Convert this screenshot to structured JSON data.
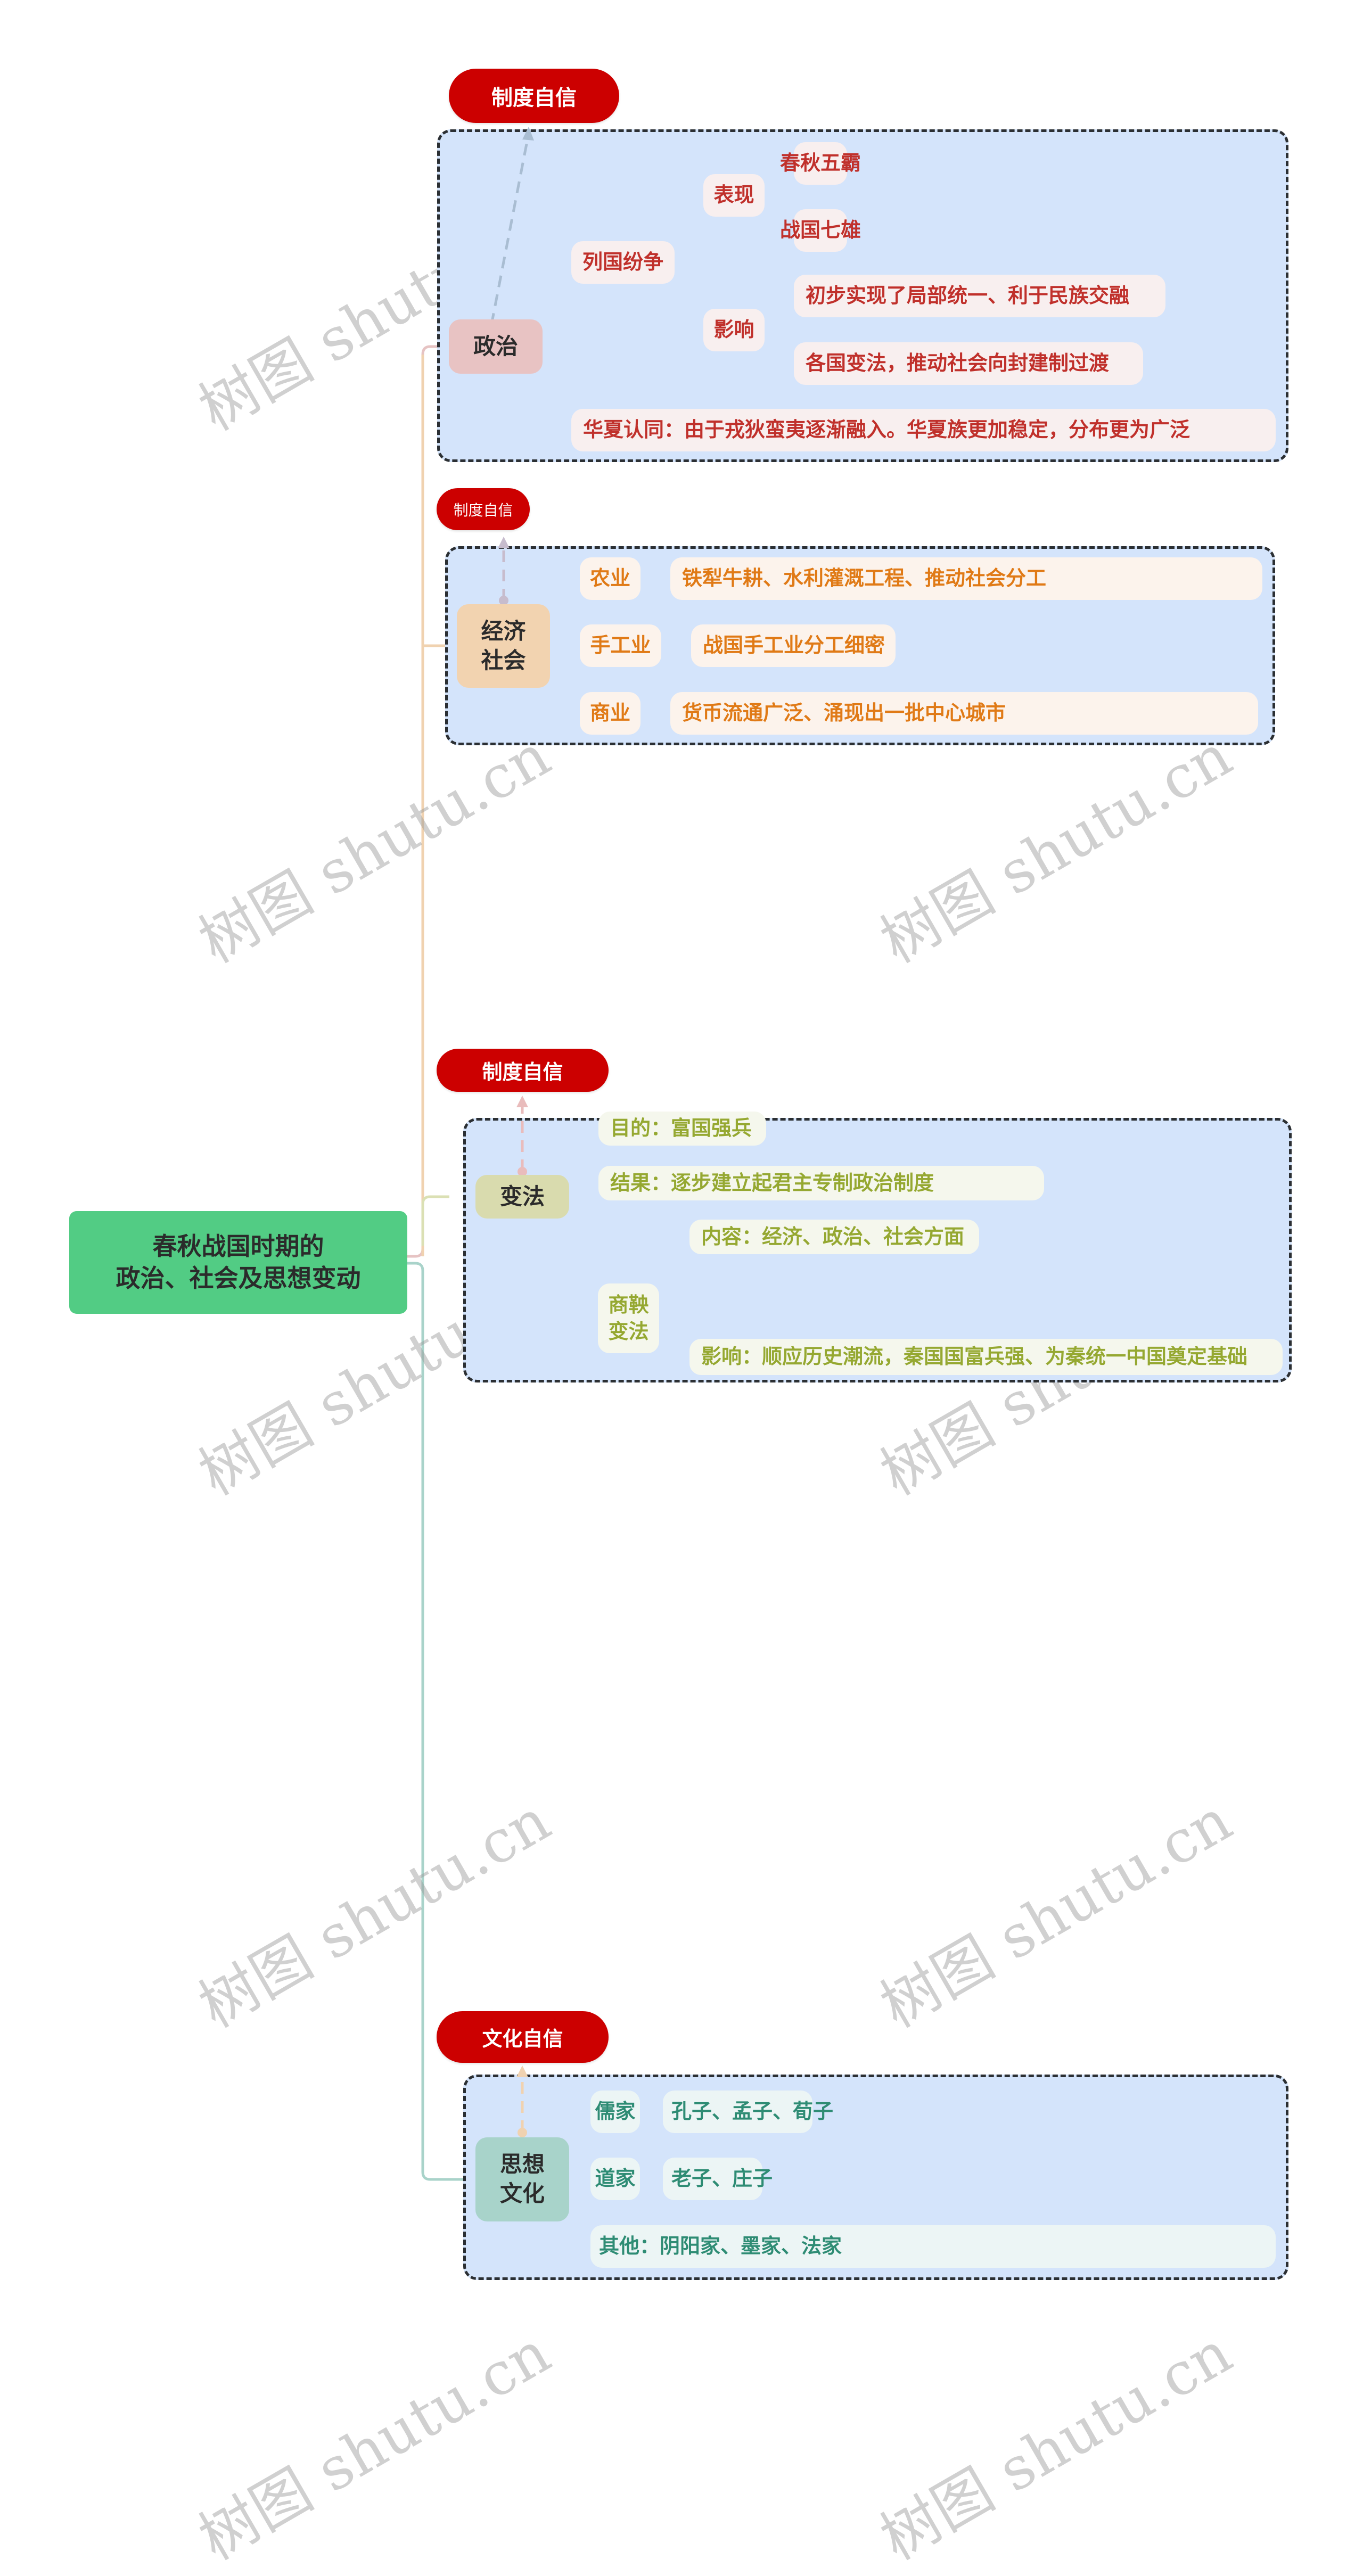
{
  "root": {
    "line1": "春秋战国时期的",
    "line2": "政治、社会及思想变动"
  },
  "colors": {
    "root_bg": "#52cc84",
    "pill_bg": "#cc0000",
    "group_bg": "#d4e4fb",
    "politics": "#c0302b",
    "economy": "#e07a16",
    "reform": "#95a831",
    "culture": "#2e8c74"
  },
  "sections": [
    {
      "tag": "制度自信",
      "title_lines": [
        "政治"
      ],
      "branches": [
        {
          "label": "列国纷争",
          "children": [
            {
              "label": "表现",
              "children": [
                "春秋五霸",
                "战国七雄"
              ]
            },
            {
              "label": "影响",
              "children": [
                "初步实现了局部统一、利于民族交融",
                "各国变法，推动社会向封建制过渡"
              ]
            }
          ]
        },
        {
          "label": "华夏认同：由于戎狄蛮夷逐渐融入。华夏族更加稳定，分布更为广泛"
        }
      ]
    },
    {
      "tag": "制度自信",
      "title_lines": [
        "经济",
        "社会"
      ],
      "branches": [
        {
          "label": "农业",
          "children": [
            "铁犁牛耕、水利灌溉工程、推动社会分工"
          ]
        },
        {
          "label": "手工业",
          "children": [
            "战国手工业分工细密"
          ]
        },
        {
          "label": "商业",
          "children": [
            "货币流通广泛、涌现出一批中心城市"
          ]
        }
      ]
    },
    {
      "tag": "制度自信",
      "title_lines": [
        "变法"
      ],
      "branches": [
        {
          "label": "目的：富国强兵"
        },
        {
          "label": "结果：逐步建立起君主专制政治制度"
        },
        {
          "label_lines": [
            "商鞅",
            "变法"
          ],
          "children": [
            "内容：经济、政治、社会方面",
            "影响：顺应历史潮流，秦国国富兵强、为秦统一中国奠定基础"
          ]
        }
      ]
    },
    {
      "tag": "文化自信",
      "title_lines": [
        "思想",
        "文化"
      ],
      "branches": [
        {
          "label": "儒家",
          "children": [
            "孔子、孟子、荀子"
          ]
        },
        {
          "label": "道家",
          "children": [
            "老子、庄子"
          ]
        },
        {
          "label": "其他：阴阳家、墨家、法家"
        }
      ]
    }
  ],
  "watermark": "树图 shutu.cn"
}
